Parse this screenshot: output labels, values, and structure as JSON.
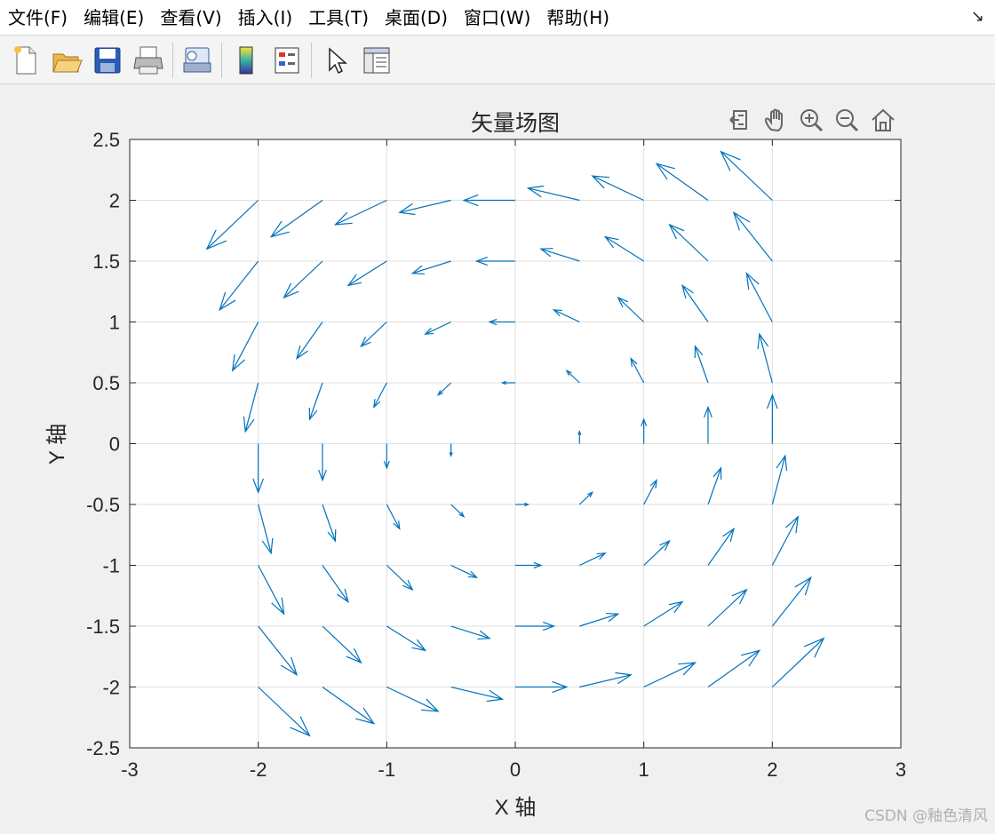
{
  "menubar": {
    "items": [
      "文件(F)",
      "编辑(E)",
      "查看(V)",
      "插入(I)",
      "工具(T)",
      "桌面(D)",
      "窗口(W)",
      "帮助(H)"
    ],
    "dock_arrow": "↘"
  },
  "toolbar": {
    "icons": [
      "new-file-icon",
      "open-folder-icon",
      "save-icon",
      "print-icon",
      "print-preview-icon",
      "colorbar-icon",
      "legend-icon",
      "pointer-icon",
      "property-inspector-icon"
    ]
  },
  "axes_toolbar": {
    "icons": [
      "export-icon",
      "pan-icon",
      "zoom-in-icon",
      "zoom-out-icon",
      "home-icon"
    ]
  },
  "colors": {
    "quiver": "#0072bd",
    "grid": "#dfdfdf",
    "axis": "#262626"
  },
  "watermark": "CSDN @釉色清风",
  "chart_data": {
    "type": "quiver",
    "title": "矢量场图",
    "xlabel": "X 轴",
    "ylabel": "Y 轴",
    "xlim": [
      -3,
      3
    ],
    "ylim": [
      -2.5,
      2.5
    ],
    "xticks": [
      -3,
      -2,
      -1,
      0,
      1,
      2,
      3
    ],
    "yticks": [
      -2.5,
      -2,
      -1.5,
      -1,
      -0.5,
      0,
      0.5,
      1,
      1.5,
      2,
      2.5
    ],
    "xtick_labels": [
      "-3",
      "-2",
      "-1",
      "0",
      "1",
      "2",
      "3"
    ],
    "ytick_labels": [
      "-2.5",
      "-2",
      "-1.5",
      "-1",
      "-0.5",
      "0",
      "0.5",
      "1",
      "1.5",
      "2",
      "2.5"
    ],
    "grid": true,
    "field": {
      "u": "-y",
      "v": "x"
    },
    "x": [
      -2,
      -1.5,
      -1,
      -0.5,
      0,
      0.5,
      1,
      1.5,
      2
    ],
    "y": [
      -2,
      -1.5,
      -1,
      -0.5,
      0,
      0.5,
      1,
      1.5,
      2
    ],
    "scale": 0.2
  }
}
